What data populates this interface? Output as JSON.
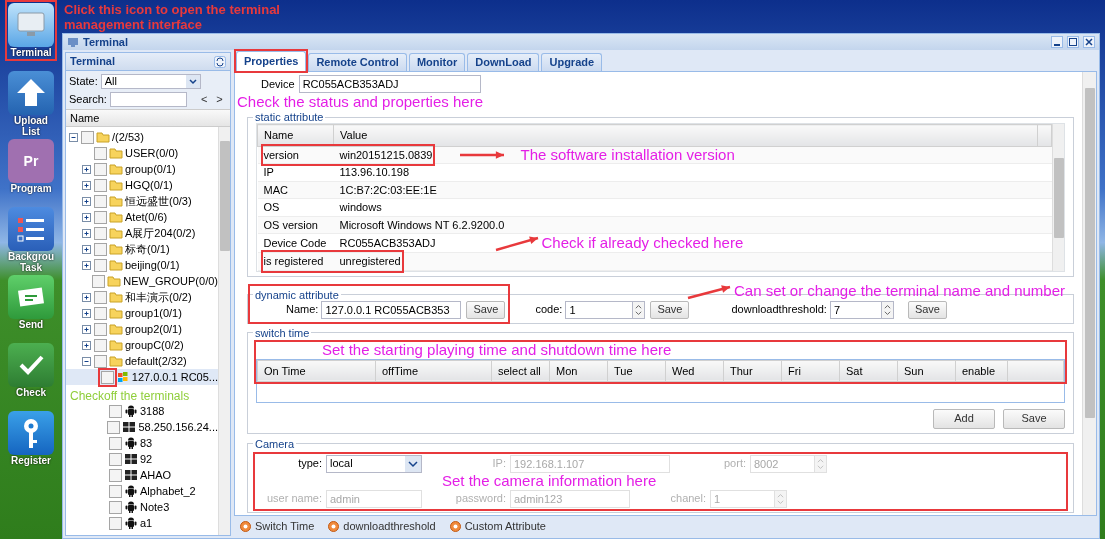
{
  "dock": [
    {
      "kind": "monitor",
      "lines": [
        "Terminal"
      ],
      "note": {
        "text": "Click this icon to open the terminal management interface",
        "color": "#e8393c"
      }
    },
    {
      "kind": "upload",
      "lines": [
        "Upload",
        "List"
      ]
    },
    {
      "kind": "badge",
      "badge": "Pr",
      "lines": [
        "Program"
      ]
    },
    {
      "kind": "checklist",
      "lines": [
        "Backgrou",
        "Task"
      ]
    },
    {
      "kind": "envelope",
      "lines": [
        "Send"
      ]
    },
    {
      "kind": "check",
      "lines": [
        "Check"
      ]
    },
    {
      "kind": "key",
      "lines": [
        "Register"
      ]
    }
  ],
  "window": {
    "title": "Terminal"
  },
  "left_panel": {
    "title": "Terminal",
    "state_label": "State:",
    "state_value": "All",
    "search_label": "Search:",
    "prev": "<",
    "next": ">",
    "column": "Name",
    "tree": [
      {
        "label": "/(2/53)",
        "kind": "folder",
        "expanded": true,
        "checked": false,
        "selected": false,
        "children": [
          {
            "label": "USER(0/0)",
            "kind": "folder",
            "checked": false,
            "selected": false
          },
          {
            "label": "group(0/1)",
            "kind": "folder",
            "expanded": false,
            "checked": false,
            "selected": false
          },
          {
            "label": "HGQ(0/1)",
            "kind": "folder",
            "expanded": false,
            "checked": false,
            "selected": false
          },
          {
            "label": "恒远盛世(0/3)",
            "kind": "folder",
            "expanded": false,
            "checked": false,
            "selected": false
          },
          {
            "label": "Atet(0/6)",
            "kind": "folder",
            "expanded": false,
            "checked": false,
            "selected": false
          },
          {
            "label": "A展厅204(0/2)",
            "kind": "folder",
            "expanded": false,
            "checked": false,
            "selected": false
          },
          {
            "label": "标奇(0/1)",
            "kind": "folder",
            "expanded": false,
            "checked": false,
            "selected": false
          },
          {
            "label": "beijing(0/1)",
            "kind": "folder",
            "expanded": false,
            "checked": false,
            "selected": false
          },
          {
            "label": "NEW_GROUP(0/0)",
            "kind": "folder",
            "checked": false,
            "selected": false
          },
          {
            "label": "和丰演示(0/2)",
            "kind": "folder",
            "expanded": false,
            "checked": false,
            "selected": false
          },
          {
            "label": "group1(0/1)",
            "kind": "folder",
            "expanded": false,
            "checked": false,
            "selected": false
          },
          {
            "label": "group2(0/1)",
            "kind": "folder",
            "expanded": false,
            "checked": false,
            "selected": false
          },
          {
            "label": "groupC(0/2)",
            "kind": "folder",
            "expanded": false,
            "checked": false,
            "selected": false
          },
          {
            "label": "default(2/32)",
            "kind": "folder",
            "expanded": true,
            "checked": false,
            "selected": false,
            "children": [
              {
                "label": "127.0.0.1 RC05...",
                "kind": "mixed",
                "checked": false,
                "selected": true,
                "note": {
                  "text": "Checkoff the terminals",
                  "color": "#8fce3a"
                }
              },
              {
                "label": "3188",
                "kind": "android",
                "checked": false,
                "selected": false
              },
              {
                "label": "58.250.156.24...",
                "kind": "windows",
                "checked": false,
                "selected": false
              },
              {
                "label": "83",
                "kind": "android",
                "checked": false,
                "selected": false
              },
              {
                "label": "92",
                "kind": "windows",
                "checked": false,
                "selected": false
              },
              {
                "label": "AHAO",
                "kind": "windows",
                "checked": false,
                "selected": false
              },
              {
                "label": "Alphabet_2",
                "kind": "android",
                "checked": false,
                "selected": false
              },
              {
                "label": "Note3",
                "kind": "android",
                "checked": false,
                "selected": false
              },
              {
                "label": "a1",
                "kind": "android",
                "checked": false,
                "selected": false
              }
            ]
          }
        ]
      }
    ]
  },
  "tabs": [
    {
      "label": "Properties",
      "selected": true
    },
    {
      "label": "Remote Control",
      "selected": false
    },
    {
      "label": "Monitor",
      "selected": false
    },
    {
      "label": "DownLoad",
      "selected": false
    },
    {
      "label": "Upgrade",
      "selected": false
    }
  ],
  "properties": {
    "note": {
      "text": "Check the status and properties here",
      "color": "#e41ee6"
    },
    "device": {
      "label": "Device",
      "value": "RC055ACB353ADJ"
    },
    "static_attribute": {
      "legend": "static attribute",
      "columns": [
        "Name",
        "Value"
      ],
      "rows": [
        {
          "name": "version",
          "value": "win20151215.0839",
          "note": {
            "text": "The software installation version",
            "color": "#e41ee6"
          }
        },
        {
          "name": "IP",
          "value": "113.96.10.198"
        },
        {
          "name": "MAC",
          "value": "1C:B7:2C:03:EE:1E"
        },
        {
          "name": "OS",
          "value": "windows"
        },
        {
          "name": "OS version",
          "value": "Microsoft Windows NT 6.2.9200.0"
        },
        {
          "name": "Device Code",
          "value": "RC055ACB353ADJ",
          "note": {
            "text": "Check if already checked here",
            "color": "#e41ee6"
          }
        },
        {
          "name": "is registered",
          "value": "unregistered"
        }
      ]
    },
    "dynamic_attribute": {
      "legend": "dynamic attribute",
      "note": {
        "text": "Can set or change the terminal name and number",
        "color": "#e41ee6"
      },
      "fields": [
        {
          "label": "Name:",
          "value": "127.0.0.1 RC055ACB353",
          "kind": "text",
          "button": "Save"
        },
        {
          "label": "code:",
          "value": "1",
          "kind": "number",
          "button": "Save"
        },
        {
          "label": "downloadthreshold:",
          "value": "7",
          "kind": "number",
          "button": "Save"
        }
      ]
    },
    "switch_time": {
      "legend": "switch time",
      "note": {
        "text": "Set the starting playing time and shutdown time here",
        "color": "#e41ee6"
      },
      "columns": [
        "On Time",
        "offTime",
        "select all",
        "Mon",
        "Tue",
        "Wed",
        "Thur",
        "Fri",
        "Sat",
        "Sun",
        "enable"
      ],
      "buttons": [
        "Add",
        "Save"
      ]
    },
    "camera": {
      "legend": "Camera",
      "note": {
        "text": "Set the camera information here",
        "color": "#e41ee6"
      },
      "rows": [
        [
          {
            "label": "type:",
            "value": "local",
            "kind": "select",
            "disabled": false
          },
          {
            "label": "IP:",
            "value": "192.168.1.107",
            "kind": "text",
            "disabled": true
          },
          {
            "label": "port:",
            "value": "8002",
            "kind": "number",
            "disabled": true
          }
        ],
        [
          {
            "label": "user name:",
            "value": "admin",
            "kind": "text",
            "disabled": true
          },
          {
            "label": "password:",
            "value": "admin123",
            "kind": "text",
            "disabled": true
          },
          {
            "label": "chanel:",
            "value": "1",
            "kind": "number",
            "disabled": true
          }
        ]
      ]
    }
  },
  "status_bar": [
    "Switch Time",
    "downloadthreshold",
    "Custom Attribute"
  ]
}
